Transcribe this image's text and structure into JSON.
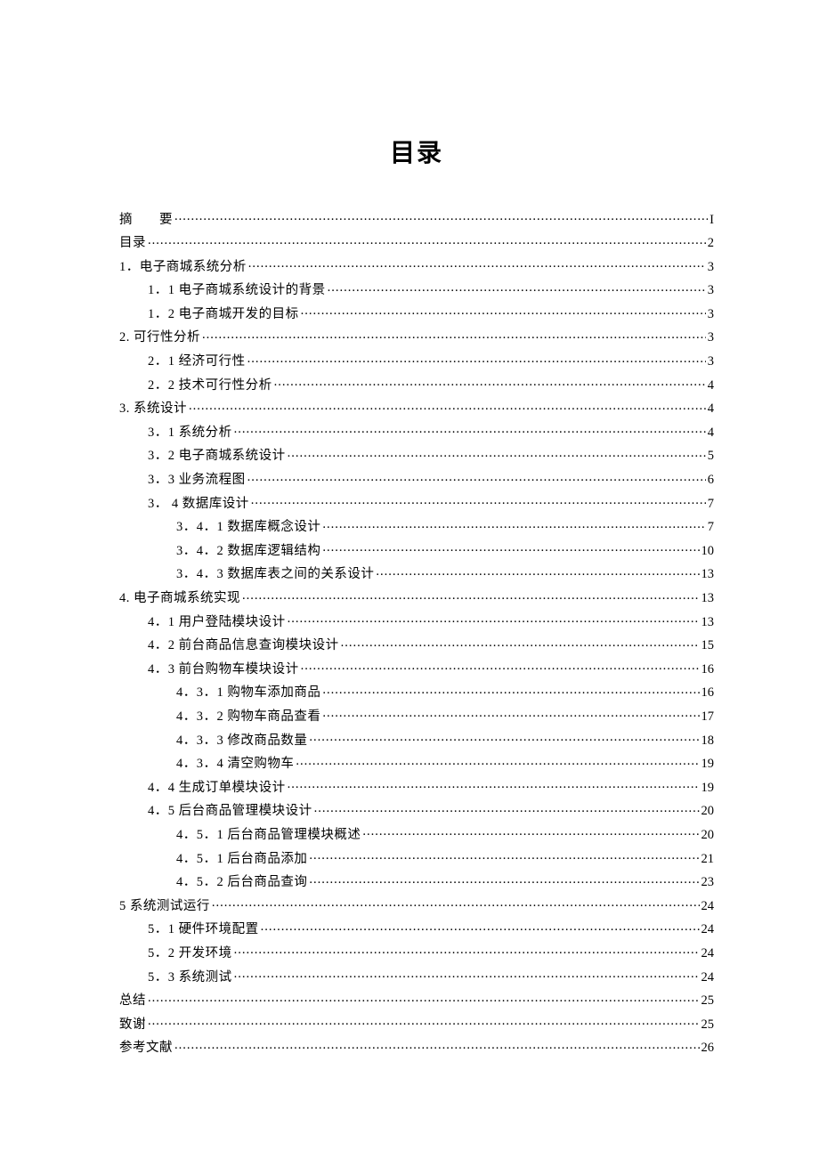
{
  "title": "目录",
  "entries": [
    {
      "indent": 0,
      "label": "摘　　要",
      "page": "I",
      "wide": false
    },
    {
      "indent": 0,
      "label": "目录",
      "page": "2"
    },
    {
      "indent": 0,
      "label": "1．电子商城系统分析",
      "page": "3"
    },
    {
      "indent": 1,
      "label": "1．1 电子商城系统设计的背景",
      "page": "3"
    },
    {
      "indent": 1,
      "label": "1．2 电子商城开发的目标",
      "page": "3"
    },
    {
      "indent": 0,
      "label": "2. 可行性分析",
      "page": "3"
    },
    {
      "indent": 1,
      "label": "2．1 经济可行性",
      "page": "3"
    },
    {
      "indent": 1,
      "label": "2．2 技术可行性分析",
      "page": "4"
    },
    {
      "indent": 0,
      "label": "3. 系统设计",
      "page": "4"
    },
    {
      "indent": 1,
      "label": "3．1 系统分析",
      "page": "4"
    },
    {
      "indent": 1,
      "label": "3．2  电子商城系统设计",
      "page": "5"
    },
    {
      "indent": 1,
      "label": "3．3 业务流程图",
      "page": "6"
    },
    {
      "indent": 1,
      "label": "3． 4 数据库设计",
      "page": "7"
    },
    {
      "indent": 2,
      "label": "3．4．1 数据库概念设计",
      "page": "7"
    },
    {
      "indent": 2,
      "label": "3．4．2 数据库逻辑结构",
      "page": "10"
    },
    {
      "indent": 2,
      "label": "3．4．3 数据库表之间的关系设计",
      "page": "13"
    },
    {
      "indent": 0,
      "label": "4. 电子商城系统实现",
      "page": "13"
    },
    {
      "indent": 1,
      "label": "4．1 用户登陆模块设计",
      "page": "13"
    },
    {
      "indent": 1,
      "label": "4．2 前台商品信息查询模块设计",
      "page": "15"
    },
    {
      "indent": 1,
      "label": "4．3 前台购物车模块设计",
      "page": "16"
    },
    {
      "indent": 2,
      "label": "4．3．1 购物车添加商品",
      "page": "16"
    },
    {
      "indent": 2,
      "label": "4．3．2 购物车商品查看",
      "page": "17"
    },
    {
      "indent": 2,
      "label": "4．3．3 修改商品数量",
      "page": "18"
    },
    {
      "indent": 2,
      "label": "4．3．4 清空购物车",
      "page": "19"
    },
    {
      "indent": 1,
      "label": "4．4 生成订单模块设计",
      "page": "19"
    },
    {
      "indent": 1,
      "label": "4．5 后台商品管理模块设计",
      "page": "20"
    },
    {
      "indent": 2,
      "label": "4．5．1 后台商品管理模块概述",
      "page": "20"
    },
    {
      "indent": 2,
      "label": "4．5．1 后台商品添加",
      "page": "21"
    },
    {
      "indent": 2,
      "label": "4．5．2 后台商品查询",
      "page": "23"
    },
    {
      "indent": 0,
      "label": "5 系统测试运行",
      "page": "24"
    },
    {
      "indent": 1,
      "label": "5．1 硬件环境配置",
      "page": "24"
    },
    {
      "indent": 1,
      "label": "5．2 开发环境",
      "page": "24"
    },
    {
      "indent": 1,
      "label": "5．3  系统测试",
      "page": "24"
    },
    {
      "indent": 0,
      "label": "总结",
      "page": "25"
    },
    {
      "indent": 0,
      "label": "致谢",
      "page": "25"
    },
    {
      "indent": 0,
      "label": "参考文献",
      "page": "26"
    }
  ]
}
